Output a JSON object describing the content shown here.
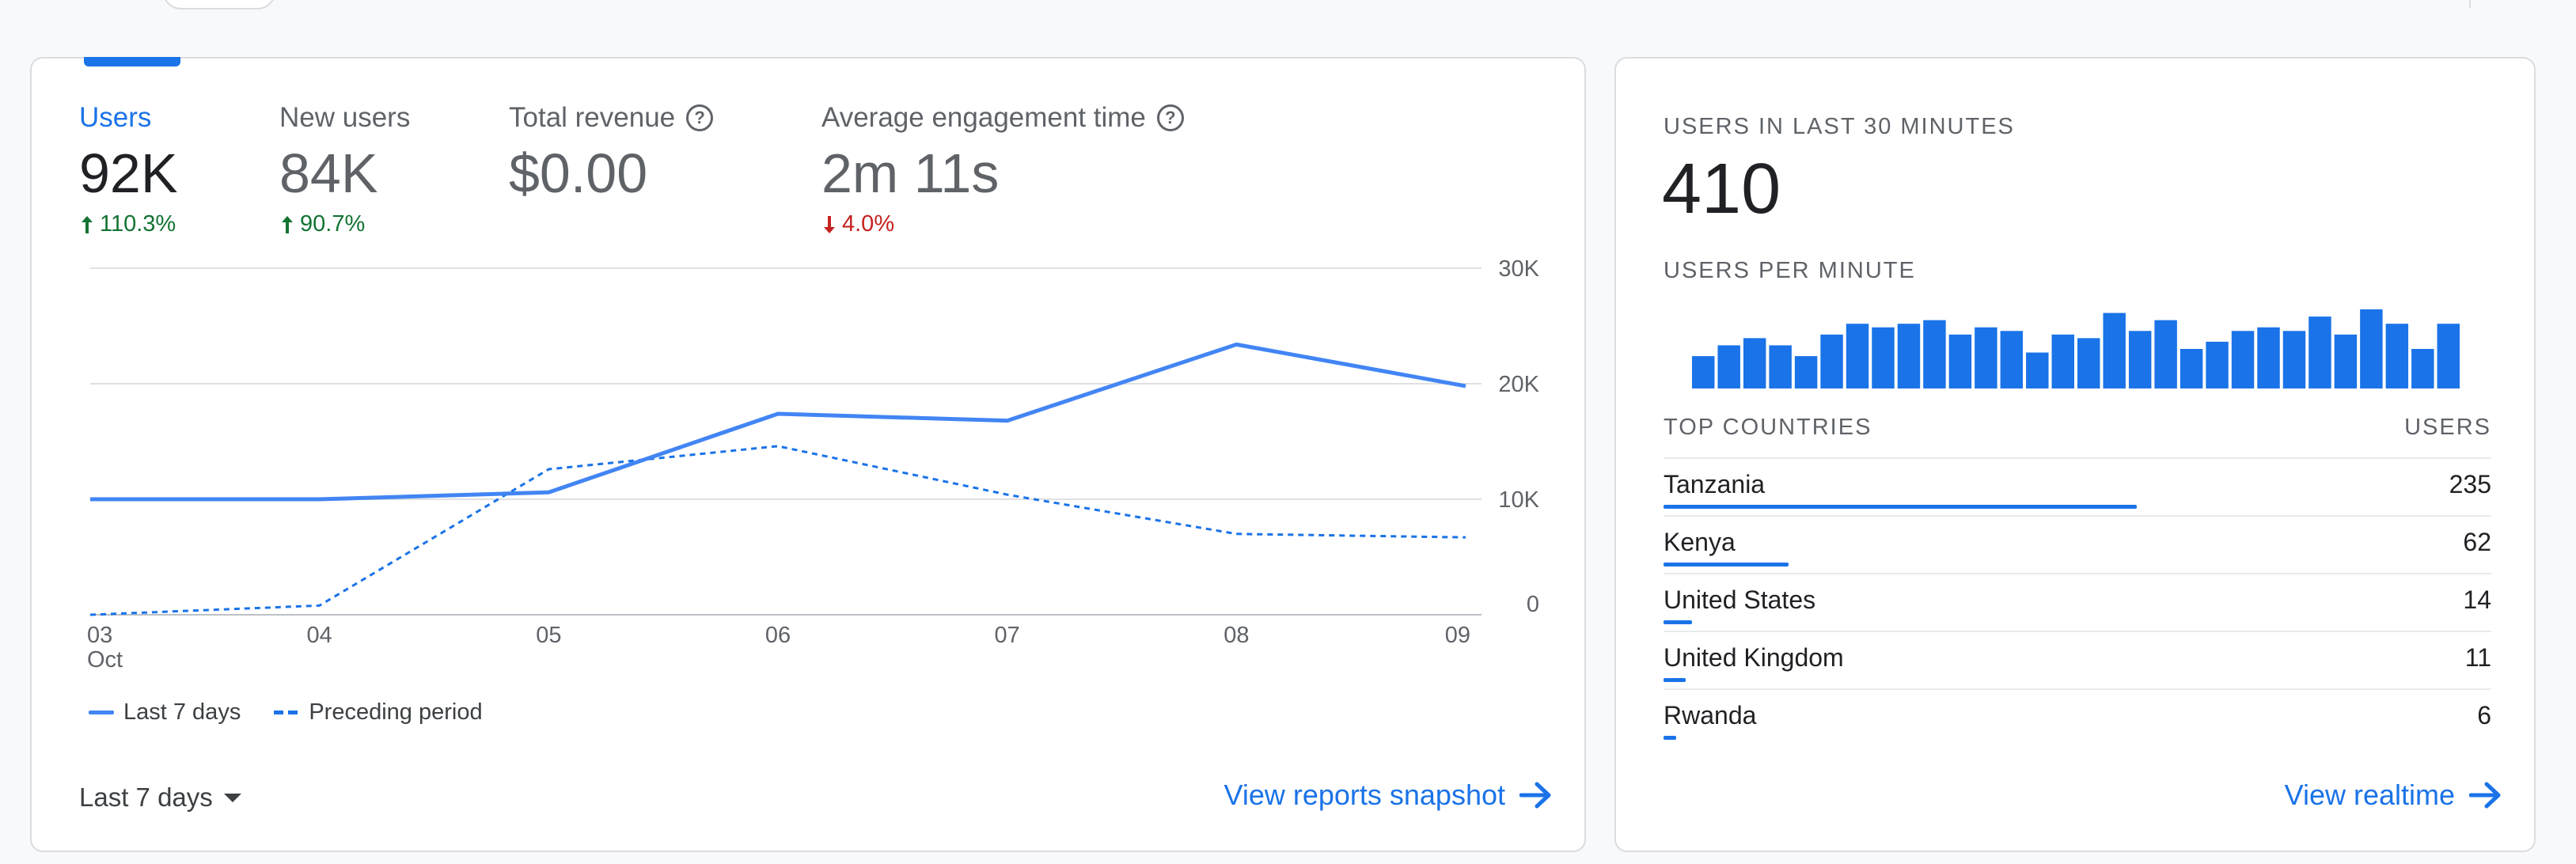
{
  "overview": {
    "metrics": [
      {
        "label": "Users",
        "value": "92K",
        "change": "110.3%",
        "direction": "up",
        "active": true,
        "help": false
      },
      {
        "label": "New users",
        "value": "84K",
        "change": "90.7%",
        "direction": "up",
        "active": false,
        "help": false
      },
      {
        "label": "Total revenue",
        "value": "$0.00",
        "change": "",
        "direction": "",
        "active": false,
        "help": true
      },
      {
        "label": "Average engagement time",
        "value": "2m 11s",
        "change": "4.0%",
        "direction": "down",
        "active": false,
        "help": true
      }
    ],
    "period_select": "Last 7 days",
    "view_link": "View reports snapshot"
  },
  "chart_data": {
    "type": "line",
    "x": [
      "03",
      "04",
      "05",
      "06",
      "07",
      "08",
      "09"
    ],
    "x_sublabel": "Oct",
    "y_ticks": [
      "0",
      "10K",
      "20K",
      "30K"
    ],
    "ylim": [
      0,
      30000
    ],
    "grid": true,
    "legend": "bottom-left",
    "series": [
      {
        "name": "Last 7 days",
        "style": "solid",
        "color": "#4285f4",
        "values": [
          10000,
          10000,
          10600,
          17400,
          16800,
          23400,
          19800
        ]
      },
      {
        "name": "Preceding period",
        "style": "dashed",
        "color": "#1a73e8",
        "values": [
          0,
          800,
          12600,
          14600,
          10400,
          7000,
          6700
        ]
      }
    ]
  },
  "realtime": {
    "users_label": "USERS IN LAST 30 MINUTES",
    "users_value": "410",
    "per_minute_label": "USERS PER MINUTE",
    "per_minute_values": [
      9,
      12,
      14,
      12,
      9,
      15,
      18,
      17,
      18,
      19,
      15,
      17,
      16,
      10,
      15,
      14,
      21,
      16,
      19,
      11,
      13,
      16,
      17,
      16,
      20,
      15,
      22,
      18,
      11,
      18
    ],
    "countries_header": "TOP COUNTRIES",
    "users_header": "USERS",
    "countries": [
      {
        "name": "Tanzania",
        "users": "235",
        "share": 0.572
      },
      {
        "name": "Kenya",
        "users": "62",
        "share": 0.151
      },
      {
        "name": "United States",
        "users": "14",
        "share": 0.034
      },
      {
        "name": "United Kingdom",
        "users": "11",
        "share": 0.027
      },
      {
        "name": "Rwanda",
        "users": "6",
        "share": 0.015
      }
    ],
    "view_link": "View realtime"
  },
  "colors": {
    "accent": "#1a73e8",
    "up": "#137333",
    "down": "#c5221f"
  }
}
